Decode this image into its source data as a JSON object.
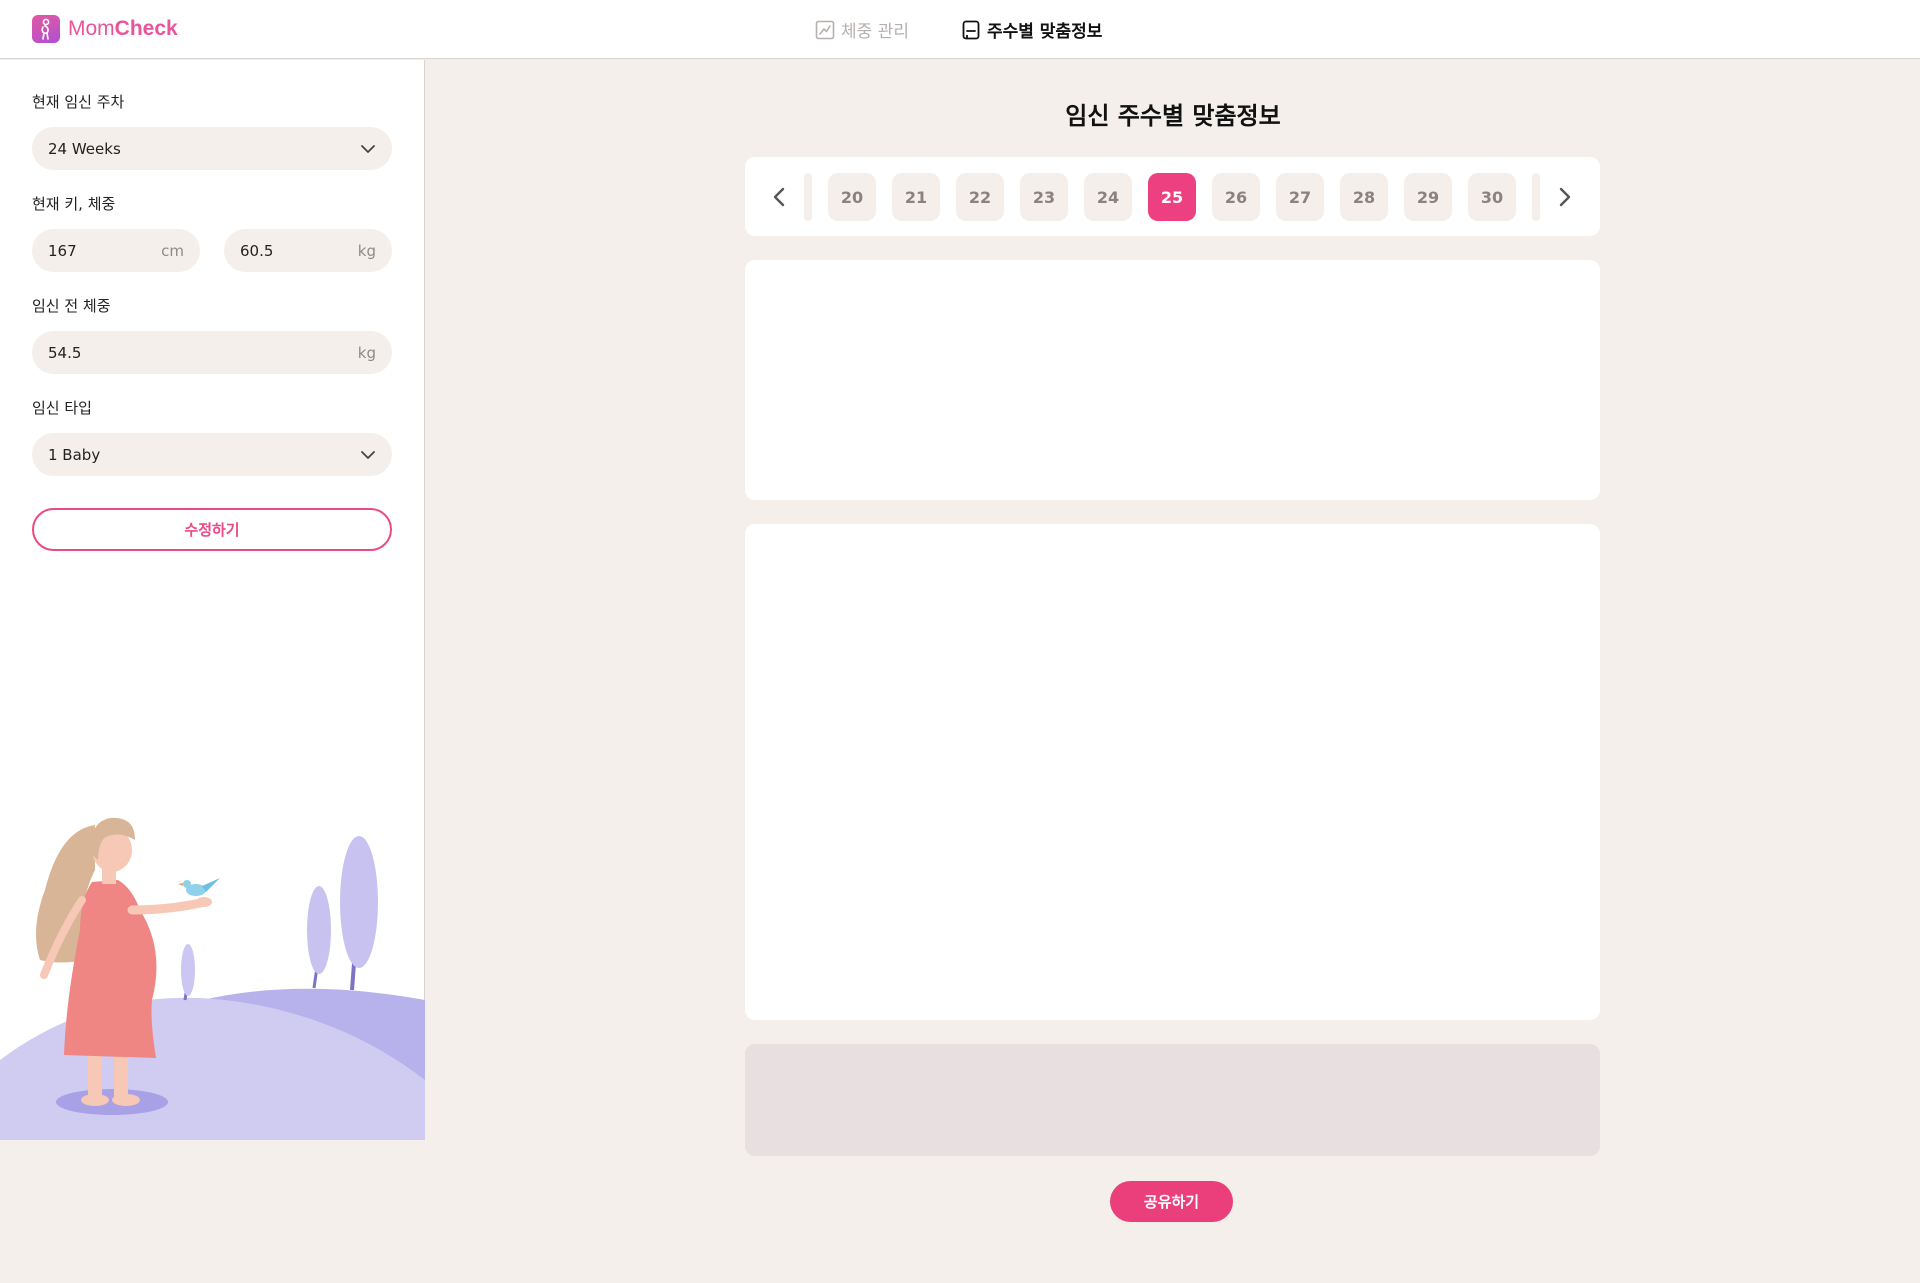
{
  "header": {
    "logo_part1": "Mom",
    "logo_part2": "Check",
    "nav": [
      {
        "label": "체중 관리",
        "icon": "chart-line-icon",
        "active": false
      },
      {
        "label": "주수별 맞춤정보",
        "icon": "notebook-icon",
        "active": true
      }
    ]
  },
  "sidebar": {
    "week_label": "현재 임신 주차",
    "week_value": "24 Weeks",
    "height_weight_label": "현재 키, 체중",
    "height_value": "167",
    "height_unit": "cm",
    "weight_value": "60.5",
    "weight_unit": "kg",
    "prepreg_label": "임신 전 체중",
    "prepreg_value": "54.5",
    "prepreg_unit": "kg",
    "type_label": "임신 타입",
    "type_value": "1 Baby",
    "edit_button": "수정하기"
  },
  "main": {
    "title": "임신 주수별 맞춤정보",
    "weeks": [
      "20",
      "21",
      "22",
      "23",
      "24",
      "25",
      "26",
      "27",
      "28",
      "29",
      "30"
    ],
    "selected_week": "25",
    "share_button": "공유하기"
  },
  "colors": {
    "accent": "#ec4080",
    "background": "#f4efeb",
    "chip": "#f4efeb",
    "muted_card": "#e8dfe0"
  }
}
